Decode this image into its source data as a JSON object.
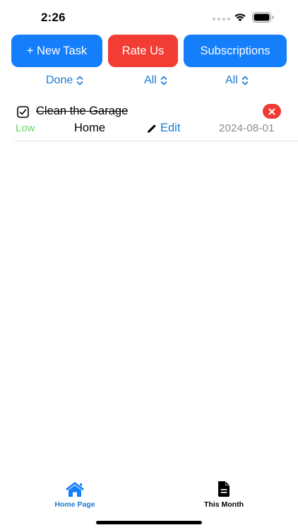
{
  "status_bar": {
    "time": "2:26",
    "icons": [
      "signal-dots-icon",
      "wifi-icon",
      "battery-icon"
    ]
  },
  "actions": {
    "new_task_label": "+ New Task",
    "rate_label": "Rate Us",
    "subscriptions_label": "Subscriptions"
  },
  "filters": {
    "status": "Done",
    "category": "All",
    "priority": "All"
  },
  "tasks": [
    {
      "title": "Clean the Garage",
      "completed": true,
      "priority": "Low",
      "category": "Home",
      "edit_label": "Edit",
      "date": "2024-08-01"
    }
  ],
  "tabs": [
    {
      "label": "Home Page",
      "icon": "house-icon",
      "active": true
    },
    {
      "label": "This Month",
      "icon": "document-icon",
      "active": false
    }
  ],
  "colors": {
    "accent_blue": "#157efb",
    "link_blue": "#1a7ad4",
    "rate_red": "#f23d34",
    "delete_red": "#ef3b35",
    "priority_low_green": "#6ed46e",
    "date_gray": "#8a8a8e"
  }
}
